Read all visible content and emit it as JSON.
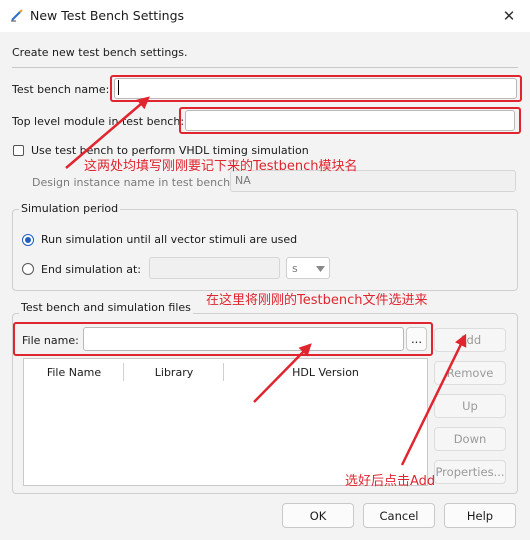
{
  "window": {
    "title": "New Test Bench Settings",
    "close_glyph": "✕",
    "icon": "wand-icon"
  },
  "description": "Create new test bench settings.",
  "fields": {
    "test_bench_name_label": "Test bench name:",
    "test_bench_name_value": "",
    "top_level_module_label": "Top level module in test bench:",
    "top_level_module_value": "",
    "vhdl_timing_label": "Use test bench to perform VHDL timing simulation",
    "vhdl_timing_checked": false,
    "design_instance_label": "Design instance name in test bench:",
    "design_instance_value": "NA"
  },
  "simulation_period": {
    "title": "Simulation period",
    "run_until_label": "Run simulation until all vector stimuli are used",
    "end_at_label": "End simulation at:",
    "end_at_value": "",
    "unit_value": "s",
    "selected": "run_until"
  },
  "files": {
    "title": "Test bench and simulation files",
    "file_name_label": "File name:",
    "file_name_value": "",
    "browse_label": "...",
    "columns": [
      "File Name",
      "Library",
      "HDL Version"
    ],
    "rows": [],
    "buttons": {
      "add": "Add",
      "remove": "Remove",
      "up": "Up",
      "down": "Down",
      "properties": "Properties..."
    }
  },
  "footer": {
    "ok": "OK",
    "cancel": "Cancel",
    "help": "Help"
  },
  "annotations": {
    "top": "这两处均填写刚刚要记下来的Testbench模块名",
    "middle": "在这里将刚刚的Testbench文件选进来",
    "bottom": "选好后点击Add",
    "color": "#e0252f"
  }
}
